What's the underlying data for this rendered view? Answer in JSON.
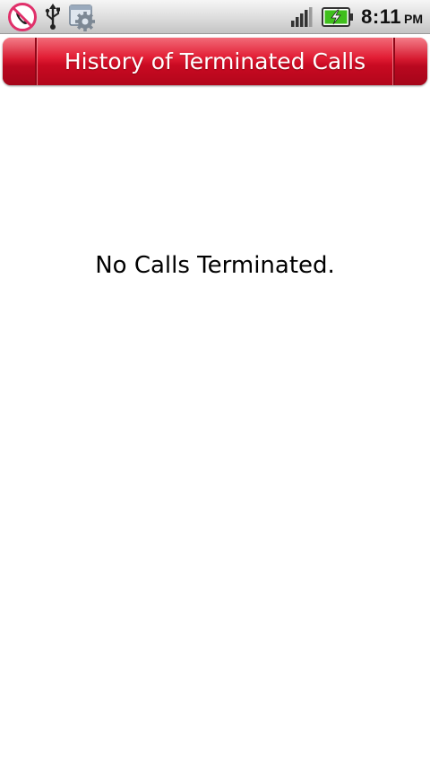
{
  "status_bar": {
    "notification_icons": [
      "call-block-icon",
      "usb-icon",
      "settings-app-icon"
    ],
    "signal_icon": "signal-strength-icon",
    "battery_icon": "battery-charging-icon",
    "time": "8:11",
    "ampm": "PM",
    "colors": {
      "battery_fill": "#3fbf1c",
      "block_ring": "#e0306a"
    }
  },
  "header": {
    "title": "History of Terminated Calls",
    "colors": {
      "bar": "#d8142c",
      "text": "#ffffff"
    }
  },
  "content": {
    "empty_message": "No Calls Terminated."
  }
}
